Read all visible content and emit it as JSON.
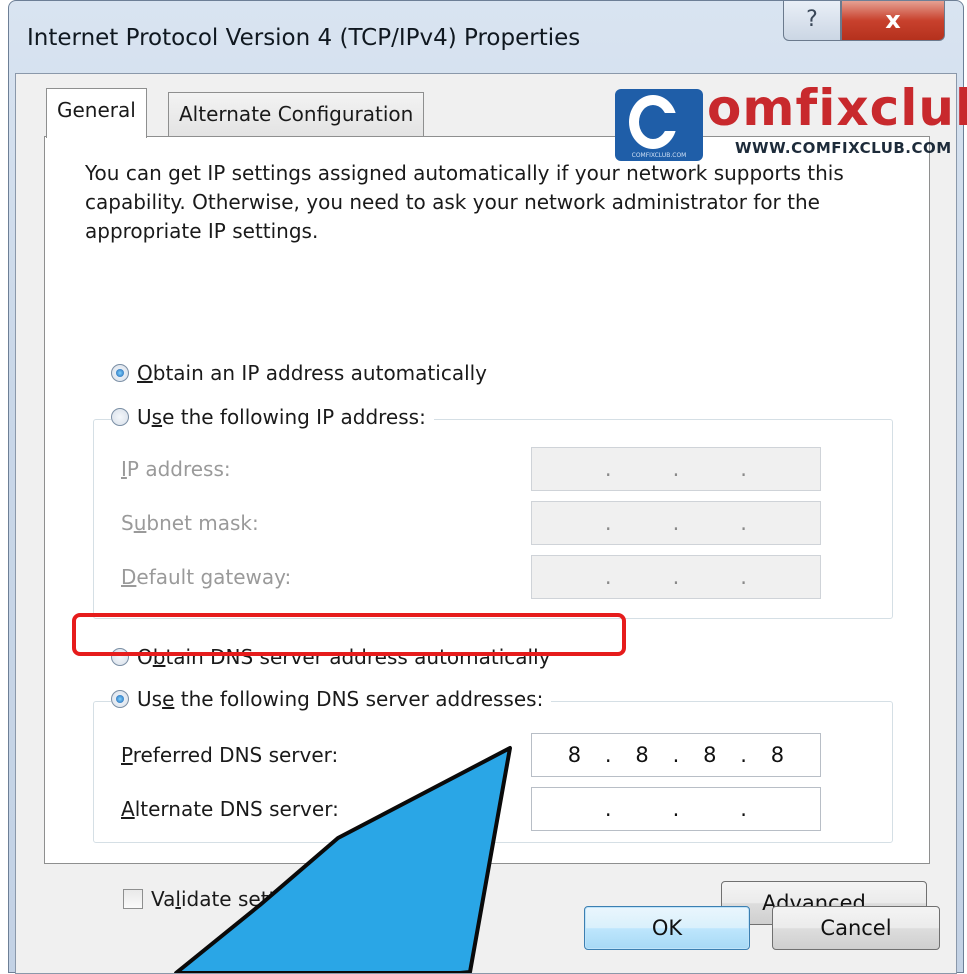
{
  "window": {
    "title": "Internet Protocol Version 4 (TCP/IPv4) Properties",
    "help_glyph": "?",
    "close_glyph": "x"
  },
  "tabs": [
    {
      "label": "General",
      "active": true
    },
    {
      "label": "Alternate Configuration",
      "active": false
    }
  ],
  "watermark": {
    "brand": "omfixclub",
    "url": "WWW.COMFIXCLUB.COM",
    "tiny_text": "COMFIXCLUB.COM",
    "colors": {
      "brand": "#c8292d",
      "badge": "#1f5ea8"
    }
  },
  "description": "You can get IP settings assigned automatically if your network supports this capability. Otherwise, you need to ask your network administrator for the appropriate IP settings.",
  "ip_mode": {
    "obtain_auto": {
      "pre": "",
      "key": "O",
      "post": "btain an IP address automatically",
      "checked": true
    },
    "use_following": {
      "pre": "U",
      "key": "s",
      "post": "e the following IP address:",
      "checked": false
    },
    "fields": [
      {
        "pre": "",
        "key": "I",
        "post": "P address:",
        "value": [
          "",
          "",
          "",
          ""
        ]
      },
      {
        "pre": "S",
        "key": "u",
        "post": "bnet mask:",
        "value": [
          "",
          "",
          "",
          ""
        ]
      },
      {
        "pre": "",
        "key": "D",
        "post": "efault gateway:",
        "value": [
          "",
          "",
          "",
          ""
        ]
      }
    ]
  },
  "dns_mode": {
    "obtain_auto": {
      "pre": "O",
      "key": "b",
      "post": "tain DNS server address automatically",
      "checked": false
    },
    "use_following": {
      "pre": "Us",
      "key": "e",
      "post": " the following DNS server addresses:",
      "checked": true
    },
    "fields": [
      {
        "pre": "",
        "key": "P",
        "post": "referred DNS server:",
        "value": [
          "8",
          "8",
          "8",
          "8"
        ]
      },
      {
        "pre": "",
        "key": "A",
        "post": "lternate DNS server:",
        "value": [
          "",
          "",
          "",
          ""
        ]
      }
    ]
  },
  "validate": {
    "pre": "Va",
    "key": "l",
    "post": "idate settings upon e",
    "checked": false
  },
  "buttons": {
    "advanced": {
      "pre": "Ad",
      "key": "v",
      "post": "anced..."
    },
    "ok": "OK",
    "cancel": "Cancel"
  },
  "annotation": {
    "highlight_color": "#e61c1c",
    "arrow_color": "#2aa6e6"
  }
}
